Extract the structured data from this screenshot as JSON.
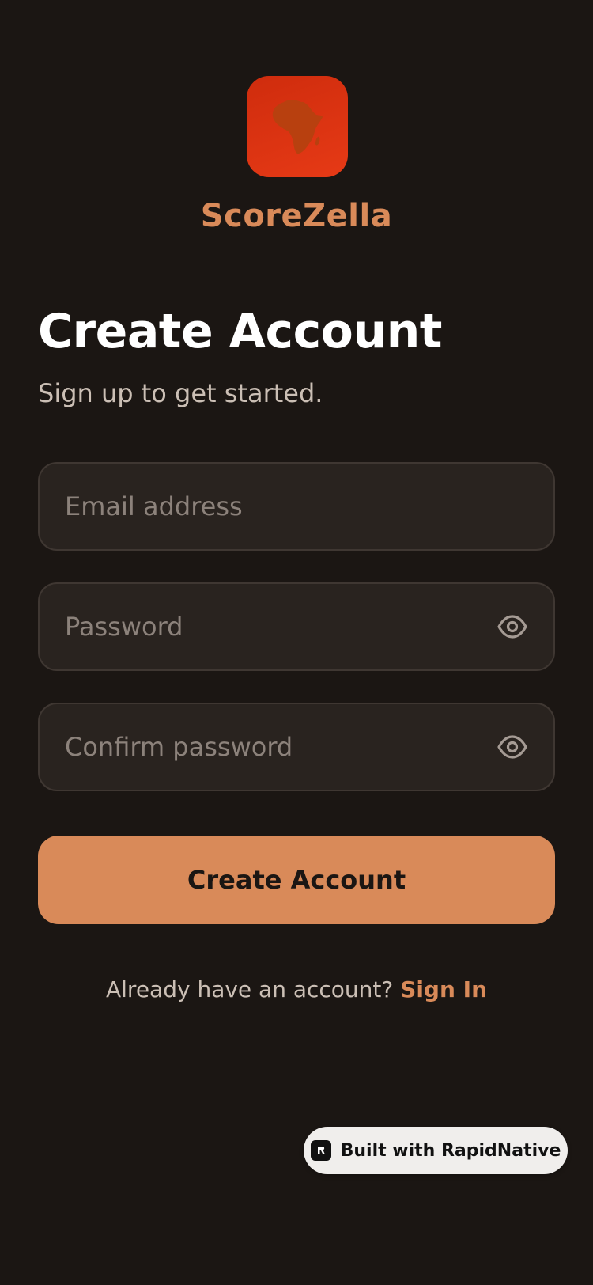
{
  "brand": {
    "name": "ScoreZella"
  },
  "heading": {
    "title": "Create Account",
    "subtitle": "Sign up to get started."
  },
  "form": {
    "email_placeholder": "Email address",
    "password_placeholder": "Password",
    "confirm_placeholder": "Confirm password",
    "submit_label": "Create Account"
  },
  "footer": {
    "prompt": "Already have an account?",
    "link_label": "Sign In"
  },
  "badge": {
    "label": "Built with RapidNative"
  },
  "icons": {
    "logo": "africa-map-icon",
    "password_toggle": "eye-icon",
    "badge_logo": "rapidnative-logo-icon"
  },
  "colors": {
    "background": "#1b1613",
    "accent": "#d98a59",
    "logo_bg": "#e03412",
    "field_bg": "#29231f"
  }
}
